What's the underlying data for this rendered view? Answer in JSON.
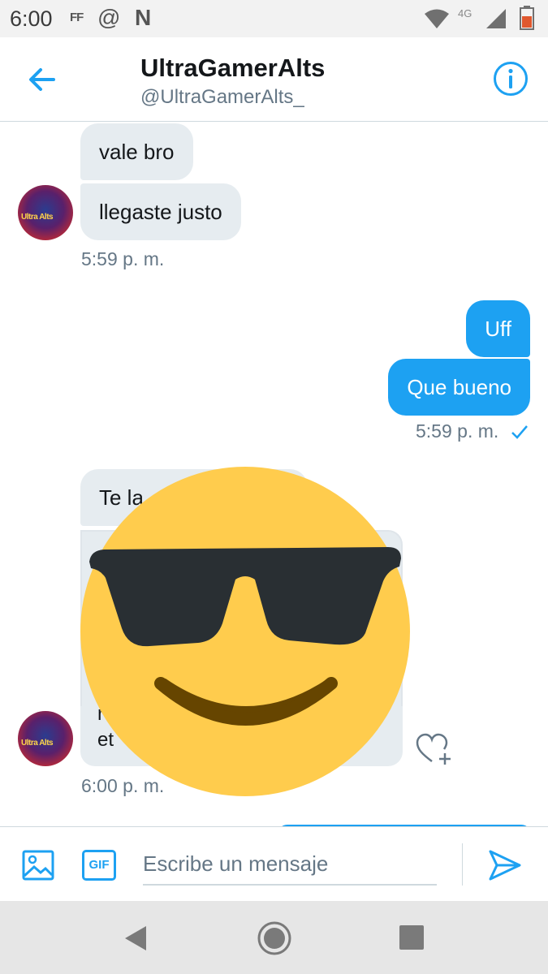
{
  "status_bar": {
    "time": "6:00",
    "icons": [
      "ff-icon",
      "at-icon",
      "netflix-icon",
      "wifi-icon",
      "signal-icon",
      "battery-icon"
    ],
    "ff": "FF",
    "at": "@",
    "n": "N",
    "network": "4G"
  },
  "header": {
    "title": "UltraGamerAlts",
    "handle": "@UltraGamerAlts_"
  },
  "messages": {
    "m1": "vale bro",
    "m2": "llegaste justo",
    "t1": "5:59 p. m.",
    "m3": "Uff",
    "m4": "Que bueno",
    "t2": "5:59 p. m.",
    "m5": "Te la",
    "card_line1": "r",
    "card_line2": "et",
    "t3": "6:00 p. m."
  },
  "composer": {
    "placeholder": "Escribe un mensaje",
    "gif_label": "GIF"
  },
  "colors": {
    "accent": "#1da1f2",
    "incoming_bubble": "#e6ecf0",
    "emoji_face": "#ffcc4d",
    "emoji_glasses": "#292f33",
    "emoji_mouth": "#664500"
  }
}
